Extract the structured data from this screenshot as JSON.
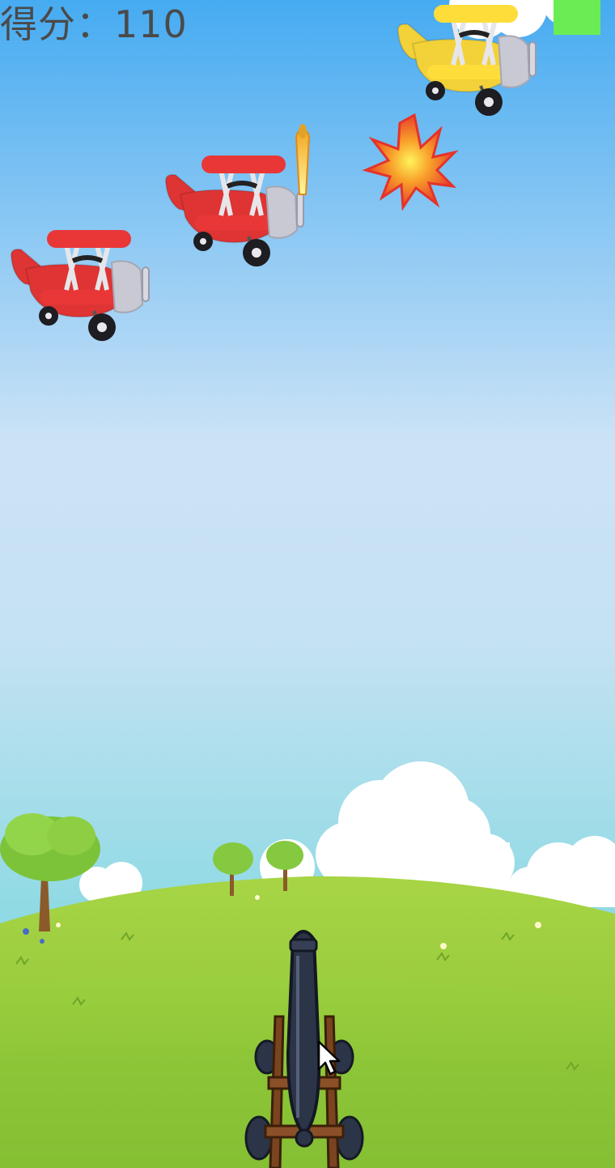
{
  "hud": {
    "score_label": "得分：",
    "score_value": "110"
  },
  "colors": {
    "sky_top": "#49aef2",
    "sky_mid": "#cde3f5",
    "sky_bottom": "#8fdae4",
    "grass_light": "#9ccd3e",
    "grass_dark": "#7bb52c",
    "indicator": "#6bec54",
    "plane_red": "#de3434",
    "plane_yellow": "#f2d238",
    "cannon": "#2c3448",
    "carriage": "#7a4420"
  },
  "icons": {
    "enemy": "biplane-icon",
    "hit": "explosion-icon",
    "shot": "cannonball-icon",
    "player": "cannon-icon",
    "pointer": "mouse-cursor-icon"
  }
}
